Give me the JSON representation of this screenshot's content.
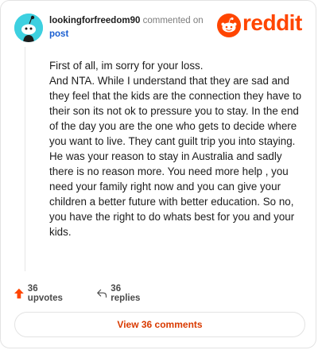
{
  "header": {
    "username": "lookingforfreedom90",
    "action_text": "commented on",
    "post_link": "post",
    "brand": "reddit"
  },
  "comment": {
    "paragraph1": "First of all, im sorry for your loss.",
    "paragraph2": "And NTA. While I understand that they are sad and they feel that the kids are the connection they have to their son its not ok to pressure you to stay. In the end of the day you are the one who gets to decide where you want to live. They cant guilt trip you into staying. He was your reason to stay in Australia and sadly there is no reason more. You need more help , you need your family right now and you can give your children a better future with better education. So no, you have the right to do whats best for you and your kids."
  },
  "actions": {
    "upvotes": "36 upvotes",
    "replies": "36 replies"
  },
  "view_comments": "View 36 comments",
  "colors": {
    "brand": "#ff4500",
    "link": "#1a5fd1",
    "view_button_text": "#d93a00",
    "avatar": "#3dd0e0"
  },
  "icons": [
    "snoo-avatar-icon",
    "reddit-logo-icon",
    "upvote-arrow-icon",
    "reply-arrow-icon"
  ]
}
